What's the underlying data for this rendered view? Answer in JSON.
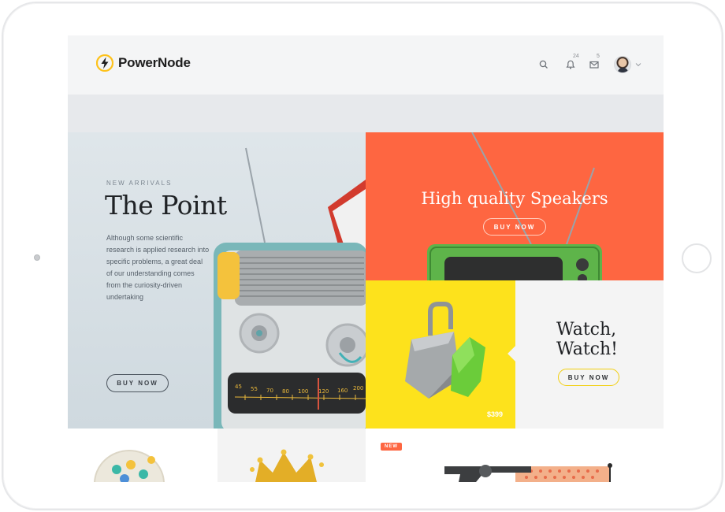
{
  "brand": {
    "name": "PowerNode",
    "accent": "#fdc21c"
  },
  "header": {
    "icons": [
      "search-icon",
      "bell-icon",
      "mail-icon"
    ],
    "notifications_count": "24",
    "messages_count": "5"
  },
  "hero": {
    "eyebrow": "NEW ARRIVALS",
    "title": "The Point",
    "description": "Although some scientific research is applied research into specific problems, a great deal of our understanding comes from the curiosity-driven undertaking",
    "button": "BUY NOW"
  },
  "speakers": {
    "title": "High quality Speakers",
    "button": "BUY NOW",
    "color": "#fe6641"
  },
  "watch": {
    "title": "Watch, Watch!",
    "price": "$399",
    "button": "BUY NOW",
    "color": "#fde21c"
  },
  "bottom": {
    "new_label": "NEW"
  }
}
